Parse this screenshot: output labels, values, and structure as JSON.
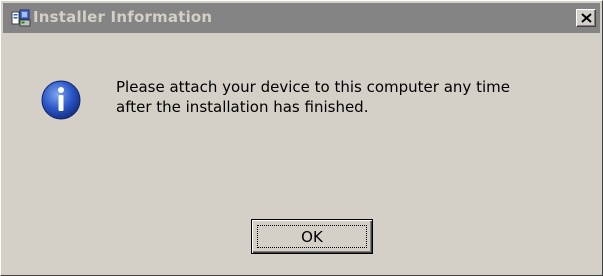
{
  "window": {
    "title": "Installer Information"
  },
  "icons": {
    "app": "installer-icon",
    "message": "information-icon",
    "close": "close-icon"
  },
  "message": {
    "line1": "Please attach your device to this computer any time",
    "line2": "after the installation has finished."
  },
  "buttons": {
    "ok_label": "OK"
  },
  "colors": {
    "dialog_bg": "#d4d0c8",
    "titlebar_inactive": "#848484",
    "info_blue": "#2b57c8"
  }
}
